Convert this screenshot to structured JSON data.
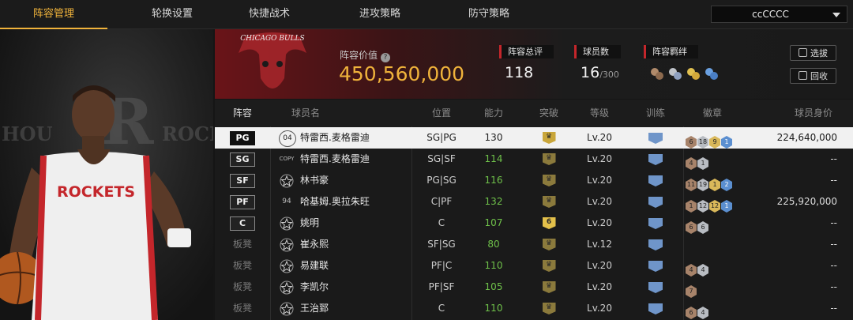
{
  "nav": {
    "tabs": [
      {
        "label": "阵容管理",
        "active": true
      },
      {
        "label": "轮换设置",
        "active": false
      },
      {
        "label": "快捷战术",
        "active": false
      },
      {
        "label": "进攻策略",
        "active": false
      },
      {
        "label": "防守策略",
        "active": false
      }
    ],
    "team_select": "ccCCCC"
  },
  "player_art": {
    "jersey_text": "ROCKETS",
    "bg_left": "HOU",
    "bg_logo": "R",
    "bg_right": "ROCK"
  },
  "summary": {
    "logo_text": "CHICAGO BULLS",
    "value_label": "阵容价值",
    "value": "450,560,000",
    "rating_label": "阵容总评",
    "rating": "118",
    "players_label": "球员数",
    "players_count": "16",
    "players_max": "/300",
    "bond_label": "阵容羁绊",
    "btn_draft": "选拔",
    "btn_recycle": "回收"
  },
  "table": {
    "headers": [
      "阵容",
      "球员名",
      "位置",
      "能力",
      "突破",
      "等级",
      "训练",
      "徽章",
      "球员身价"
    ],
    "rows": [
      {
        "slot": "PG",
        "bench": false,
        "num": "04",
        "name": "特雷西.麦格雷迪",
        "pos": "SG|PG",
        "ovr": "130",
        "ovr_green": false,
        "brk": "",
        "level": "Lv.20",
        "badges": [
          [
            "br",
            "6"
          ],
          [
            "si",
            "18"
          ],
          [
            "go",
            "9"
          ],
          [
            "bl",
            "1"
          ]
        ],
        "price": "224,640,000",
        "selected": true
      },
      {
        "slot": "SG",
        "bench": false,
        "num": "COPY",
        "name": "特雷西.麦格雷迪",
        "pos": "SG|SF",
        "ovr": "114",
        "ovr_green": true,
        "brk": "",
        "level": "Lv.20",
        "badges": [
          [
            "br",
            "4"
          ],
          [
            "si",
            "1"
          ]
        ],
        "price": "--",
        "selected": false
      },
      {
        "slot": "SF",
        "bench": false,
        "num": "",
        "name": "林书豪",
        "pos": "PG|SG",
        "ovr": "116",
        "ovr_green": true,
        "brk": "",
        "level": "Lv.20",
        "badges": [
          [
            "br",
            "11"
          ],
          [
            "si",
            "19"
          ],
          [
            "go",
            "1"
          ],
          [
            "bl",
            "2"
          ]
        ],
        "price": "--",
        "selected": false
      },
      {
        "slot": "PF",
        "bench": false,
        "num": "94",
        "name": "哈基姆.奥拉朱旺",
        "pos": "C|PF",
        "ovr": "132",
        "ovr_green": true,
        "brk": "",
        "level": "Lv.20",
        "badges": [
          [
            "br",
            "1"
          ],
          [
            "si",
            "12"
          ],
          [
            "go",
            "12"
          ],
          [
            "bl",
            "1"
          ]
        ],
        "price": "225,920,000",
        "selected": false
      },
      {
        "slot": "C",
        "bench": false,
        "num": "",
        "name": "姚明",
        "pos": "C",
        "ovr": "107",
        "ovr_green": true,
        "brk": "6",
        "level": "Lv.20",
        "badges": [
          [
            "br",
            "6"
          ],
          [
            "si",
            "6"
          ]
        ],
        "price": "--",
        "selected": false
      },
      {
        "slot": "板凳",
        "bench": true,
        "num": "",
        "name": "崔永熙",
        "pos": "SF|SG",
        "ovr": "80",
        "ovr_green": true,
        "brk": "",
        "level": "Lv.12",
        "badges": [],
        "price": "--",
        "selected": false
      },
      {
        "slot": "板凳",
        "bench": true,
        "num": "",
        "name": "易建联",
        "pos": "PF|C",
        "ovr": "110",
        "ovr_green": true,
        "brk": "",
        "level": "Lv.20",
        "badges": [
          [
            "br",
            "4"
          ],
          [
            "si",
            "4"
          ]
        ],
        "price": "--",
        "selected": false
      },
      {
        "slot": "板凳",
        "bench": true,
        "num": "",
        "name": "李凯尔",
        "pos": "PF|SF",
        "ovr": "105",
        "ovr_green": true,
        "brk": "",
        "level": "Lv.20",
        "badges": [
          [
            "br",
            "7"
          ]
        ],
        "price": "--",
        "selected": false
      },
      {
        "slot": "板凳",
        "bench": true,
        "num": "",
        "name": "王治郅",
        "pos": "C",
        "ovr": "110",
        "ovr_green": true,
        "brk": "",
        "level": "Lv.20",
        "badges": [
          [
            "br",
            "6"
          ],
          [
            "si",
            "4"
          ]
        ],
        "price": "--",
        "selected": false
      }
    ]
  },
  "colors": {
    "accent": "#f0b33b",
    "red": "#c4262b",
    "green": "#6fc14a"
  }
}
